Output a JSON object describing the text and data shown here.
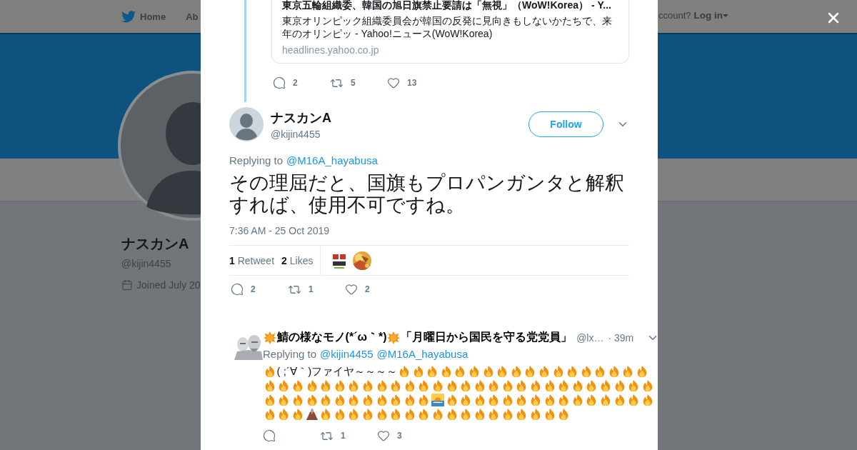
{
  "header": {
    "nav": [
      "Home",
      "Ab"
    ],
    "login_prompt": "ccount?",
    "login": "Log in"
  },
  "profile": {
    "name": "ナスカンA",
    "handle": "@kijin4455",
    "joined": "Joined July 20"
  },
  "previous_tweet": {
    "card": {
      "title": "東京五輪組織委、韓国の旭日旗禁止要請は「無視」（WoW!Korea） - Y...",
      "description": "東京オリンピック組織委員会が韓国の反発に見向きもしないかたちで、来年のオリンピッ - Yahoo!ニュース(WoW!Korea)",
      "domain": "headlines.yahoo.co.jp"
    },
    "actions": {
      "replies": "2",
      "retweets": "5",
      "likes": "13"
    }
  },
  "tweet": {
    "name": "ナスカンA",
    "handle": "@kijin4455",
    "follow": "Follow",
    "replying_label": "Replying to",
    "replying_to": [
      "@M16A_hayabusa"
    ],
    "text": "その理屈だと、国旗もプロパンガンタと解釈すれば、使用不可ですね。",
    "time": "7:36 AM - 25 Oct 2019",
    "retweet_count": "1",
    "retweet_label": "Retweet",
    "like_count": "2",
    "like_label": "Likes",
    "actions": {
      "replies": "2",
      "retweets": "1",
      "likes": "2"
    }
  },
  "reply": {
    "name_parts": [
      {
        "kind": "sun"
      },
      {
        "kind": "text",
        "text": "鯖の様なモノ(*´ω｀*)"
      },
      {
        "kind": "sun"
      },
      {
        "kind": "text",
        "text": "「月曜日から国民を守る党党員」"
      }
    ],
    "handle": "@lx…",
    "time": "· 39m",
    "replying_label": "Replying to",
    "replying_to": [
      "@kijin4455",
      "@M16A_hayabusa"
    ],
    "body": [
      {
        "kind": "fire"
      },
      {
        "kind": "text",
        "text": "( ;´∀｀)ファイヤ～～～～"
      },
      {
        "kind": "fire"
      },
      {
        "kind": "fire"
      },
      {
        "kind": "fire"
      },
      {
        "kind": "fire"
      },
      {
        "kind": "fire"
      },
      {
        "kind": "fire"
      },
      {
        "kind": "fire"
      },
      {
        "kind": "fire"
      },
      {
        "kind": "fire"
      },
      {
        "kind": "fire"
      },
      {
        "kind": "fire"
      },
      {
        "kind": "fire"
      },
      {
        "kind": "fire"
      },
      {
        "kind": "fire"
      },
      {
        "kind": "fire"
      },
      {
        "kind": "fire"
      },
      {
        "kind": "fire"
      },
      {
        "kind": "fire"
      },
      {
        "kind": "fire"
      },
      {
        "kind": "fire"
      },
      {
        "kind": "fire"
      },
      {
        "kind": "fire"
      },
      {
        "kind": "fire"
      },
      {
        "kind": "fire"
      },
      {
        "kind": "fire"
      },
      {
        "kind": "fire"
      },
      {
        "kind": "fire"
      },
      {
        "kind": "fire"
      },
      {
        "kind": "fire"
      },
      {
        "kind": "fire"
      },
      {
        "kind": "fire"
      },
      {
        "kind": "fire"
      },
      {
        "kind": "fire"
      },
      {
        "kind": "fire"
      },
      {
        "kind": "fire"
      },
      {
        "kind": "fire"
      },
      {
        "kind": "fire"
      },
      {
        "kind": "fire"
      },
      {
        "kind": "fire"
      },
      {
        "kind": "fire"
      },
      {
        "kind": "fire"
      },
      {
        "kind": "fire"
      },
      {
        "kind": "fire"
      },
      {
        "kind": "fire"
      },
      {
        "kind": "fire"
      },
      {
        "kind": "fire"
      },
      {
        "kind": "fire"
      },
      {
        "kind": "fire"
      },
      {
        "kind": "fire"
      },
      {
        "kind": "fire"
      },
      {
        "kind": "fire"
      },
      {
        "kind": "fire"
      },
      {
        "kind": "fire"
      },
      {
        "kind": "fire"
      },
      {
        "kind": "fire"
      },
      {
        "kind": "fire"
      },
      {
        "kind": "fire"
      },
      {
        "kind": "fire"
      },
      {
        "kind": "sunrise"
      },
      {
        "kind": "fire"
      },
      {
        "kind": "fire"
      },
      {
        "kind": "fire"
      },
      {
        "kind": "fire"
      },
      {
        "kind": "fire"
      },
      {
        "kind": "fire"
      },
      {
        "kind": "fire"
      },
      {
        "kind": "fire"
      },
      {
        "kind": "fire"
      },
      {
        "kind": "fire"
      },
      {
        "kind": "fire"
      },
      {
        "kind": "fire"
      },
      {
        "kind": "fire"
      },
      {
        "kind": "fire"
      },
      {
        "kind": "fire"
      },
      {
        "kind": "fire"
      },
      {
        "kind": "fire"
      },
      {
        "kind": "fire"
      },
      {
        "kind": "volcano"
      },
      {
        "kind": "fire"
      },
      {
        "kind": "fire"
      },
      {
        "kind": "fire"
      },
      {
        "kind": "fire"
      },
      {
        "kind": "fire"
      },
      {
        "kind": "fire"
      },
      {
        "kind": "fire"
      },
      {
        "kind": "fire"
      },
      {
        "kind": "fire"
      },
      {
        "kind": "fire"
      },
      {
        "kind": "fire"
      },
      {
        "kind": "fire"
      },
      {
        "kind": "fire"
      },
      {
        "kind": "fire"
      },
      {
        "kind": "fire"
      },
      {
        "kind": "fire"
      },
      {
        "kind": "fire"
      },
      {
        "kind": "fire"
      }
    ],
    "actions": {
      "retweets": "1",
      "likes": "3"
    }
  }
}
